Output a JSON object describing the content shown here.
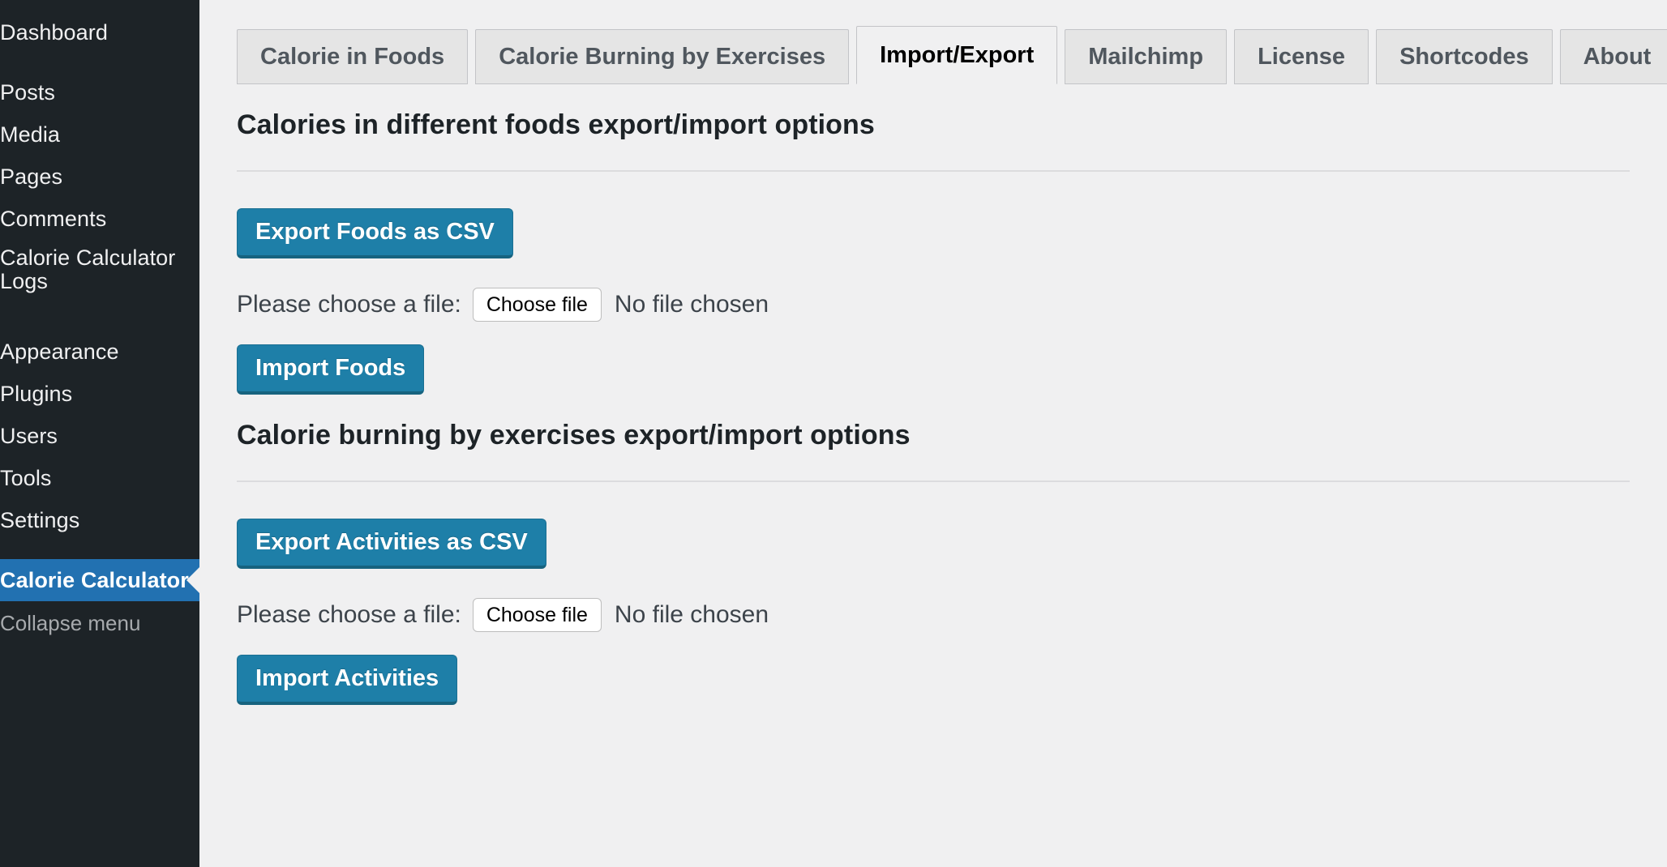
{
  "sidebar": {
    "items": [
      {
        "label": "Dashboard",
        "active": false,
        "two_line": false
      },
      {
        "label": "Posts",
        "active": false,
        "two_line": false
      },
      {
        "label": "Media",
        "active": false,
        "two_line": false
      },
      {
        "label": "Pages",
        "active": false,
        "two_line": false
      },
      {
        "label": "Comments",
        "active": false,
        "two_line": false
      },
      {
        "label": "Calorie Calculator Logs",
        "active": false,
        "two_line": true
      },
      {
        "label": "Appearance",
        "active": false,
        "two_line": false
      },
      {
        "label": "Plugins",
        "active": false,
        "two_line": false
      },
      {
        "label": "Users",
        "active": false,
        "two_line": false
      },
      {
        "label": "Tools",
        "active": false,
        "two_line": false
      },
      {
        "label": "Settings",
        "active": false,
        "two_line": false
      },
      {
        "label": "Calorie Calculator",
        "active": true,
        "two_line": false
      }
    ],
    "collapse_label": "Collapse menu",
    "background_color": "#1d2327",
    "active_color": "#2271b1",
    "text_color": "#f0f0f1",
    "collapse_color": "#a7aaad"
  },
  "tabs": [
    {
      "label": "Calorie in Foods",
      "active": false
    },
    {
      "label": "Calorie Burning by Exercises",
      "active": false
    },
    {
      "label": "Import/Export",
      "active": true
    },
    {
      "label": "Mailchimp",
      "active": false
    },
    {
      "label": "License",
      "active": false
    },
    {
      "label": "Shortcodes",
      "active": false
    },
    {
      "label": "About",
      "active": false
    }
  ],
  "sections": [
    {
      "title": "Calories in different foods export/import options",
      "export_button": "Export Foods as CSV",
      "file_label": "Please choose a file:",
      "choose_file_button": "Choose file",
      "no_file_text": "No file chosen",
      "import_button": "Import Foods"
    },
    {
      "title": "Calorie burning by exercises export/import options",
      "export_button": "Export Activities as CSV",
      "file_label": "Please choose a file:",
      "choose_file_button": "Choose file",
      "no_file_text": "No file chosen",
      "import_button": "Import Activities"
    }
  ],
  "colors": {
    "page_background": "#f0f0f1",
    "primary_button": "#1e7fa8",
    "tab_inactive": "#e5e5e5",
    "heading": "#1d2327"
  }
}
